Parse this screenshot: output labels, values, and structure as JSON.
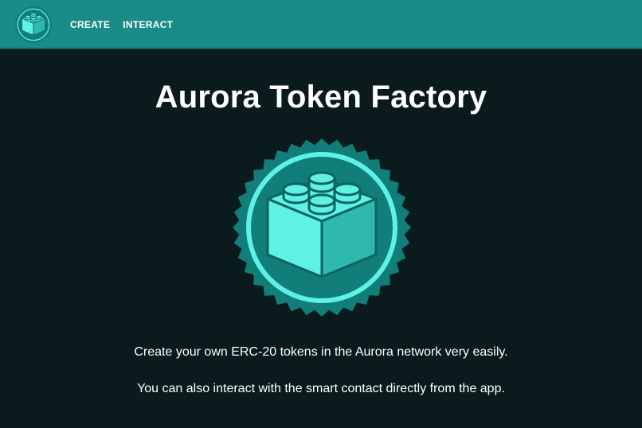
{
  "nav": {
    "logo_icon": "lego-brick-badge-icon",
    "links": [
      "CREATE",
      "INTERACT"
    ]
  },
  "main": {
    "title": "Aurora Token Factory",
    "hero_icon": "lego-brick-badge-icon",
    "description_1": "Create your own ERC-20 tokens in the Aurora network very easily.",
    "description_2": "You can also interact with the smart contact directly from the app."
  },
  "colors": {
    "nav_bg": "#1a8c87",
    "page_bg": "#0a1a1d",
    "badge_outer": "#127e79",
    "badge_ring": "#5ef2e4",
    "brick_fill": "#5ef2e4",
    "text": "#ffffff"
  }
}
